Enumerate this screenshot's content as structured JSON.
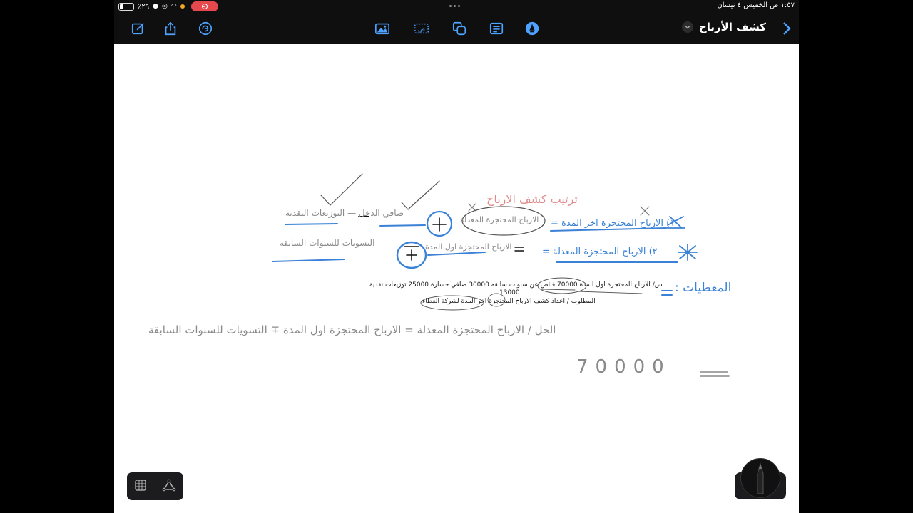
{
  "status_bar": {
    "time_date": "١:٥٧ ص   الخميس ٤ نيسان",
    "battery_percent": "٪٢٩",
    "battery_level": 0.29
  },
  "toolbar": {
    "document_title": "كشف الأرباح"
  },
  "page": {
    "heading_handwritten": "ترتيب كشف الارباح",
    "formula1_left": "١) الارباح المحتجزة اخر المدة =",
    "formula1_mid": "الارباح المحتجزة المعدلة",
    "formula1_right": "صافي الدخل — التوزيعات النقدية",
    "formula2_left": "٢) الارباح المحتجزة المعدلة =",
    "formula2_mid": "الارباح المحتجزة اول المدة",
    "formula2_right": "التسويات للسنوات السابقة",
    "givens_label": "المعطيات :",
    "question_line1": "س/ الارباح المحتجزة اول المدة 70000 فائض عن سنوات سابقه 30000 صافي خسارة 25000 توزيعات نقدية",
    "question_line2": "13000",
    "question_line3": "المطلوب / اعداد كشف الارباح المحتجزة اخر المدة لشركة العطاء",
    "solution_line": "الحل / الارباح المحتجزة المعدلة = الارباح المحتجزة اول المدة ∓ التسويات للسنوات السابقة",
    "solution_value": "70000",
    "plus_symbol": "+",
    "minus_symbol": "−"
  },
  "colors": {
    "ink_blue": "#3b82d6",
    "ink_gray": "#8a8a8a",
    "ink_red": "#e08a8a",
    "record_red": "#e5484d",
    "accent_blue": "#4da3ff"
  }
}
